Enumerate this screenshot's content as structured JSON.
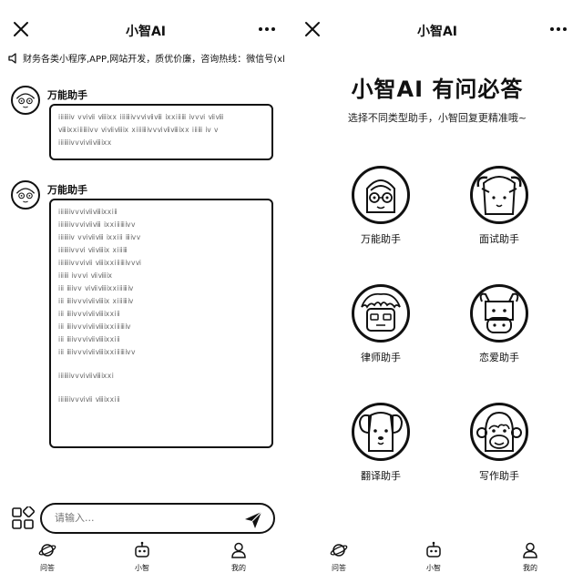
{
  "left": {
    "title": "小智AI",
    "notice": "财务各类小程序,APP,网站开发，质优价廉，咨询热线：微信号(xla",
    "messages": [
      {
        "sender": "万能助手",
        "lines": [
          "ⅰⅱⅲⅳ  ⅴⅵⅶ ⅷⅸⅹ ⅰⅱⅲⅳⅴⅵⅶⅷ ⅸⅹⅰⅱⅲ ⅳⅴⅵ ⅶⅷ",
          "ⅷⅸⅹⅰⅱⅲⅳⅴ ⅵⅶⅷⅸ ⅹⅰⅱⅲⅳⅴⅵⅶⅷⅸⅹ ⅰⅱⅲ ⅳ ⅴ",
          "ⅰⅱⅲⅳⅴⅵⅶⅷⅸⅹ"
        ]
      },
      {
        "sender": "万能助手",
        "lines": [
          "ⅰⅱⅲⅳⅴⅵⅶⅷⅸⅹⅰⅱ",
          "ⅰⅱⅲⅳⅴⅵⅶⅷ  ⅸⅹⅰⅱⅲⅳⅴ",
          "ⅰⅱⅲⅳ  ⅴⅵⅶⅷ  ⅸⅹⅰⅱ  ⅲⅳⅴ",
          "ⅰⅱⅲⅳⅴⅵ  ⅶⅷⅸ  ⅹⅰⅱⅲ",
          "ⅰⅱⅲⅳⅴⅵⅶ  ⅷⅸⅹⅰⅱⅲⅳⅴⅵ",
          "ⅰⅱⅲ  ⅳⅴⅵ  ⅶⅷⅸ",
          "ⅰⅱ  ⅲⅳⅴ  ⅵⅶⅷⅸⅹⅰⅱⅲⅳ",
          "ⅰⅱ  ⅲⅳⅴⅵⅶⅷⅸ  ⅹⅰⅱⅲⅳ",
          "ⅰⅱ  ⅲⅳⅴⅵⅶⅷⅸⅹⅰⅱ",
          "ⅰⅱ  ⅲⅳⅴⅵⅶⅷⅸⅹⅰⅱⅲⅳ",
          "ⅰⅱ  ⅲⅳⅴⅵⅶⅷⅸⅹⅰⅱ",
          "ⅰⅱ  ⅲⅳⅴⅵⅶⅷⅸⅹⅰⅱⅲⅳⅴ",
          "",
          "ⅰⅱⅲⅳⅴⅵⅶⅷⅸⅹⅰ",
          "",
          "ⅰⅱⅲⅳⅴⅵⅶ  ⅷⅸⅹⅰⅱ"
        ]
      }
    ],
    "input_placeholder": "请输入...",
    "tabs": [
      {
        "label": "问答",
        "icon": "planet-icon"
      },
      {
        "label": "小智",
        "icon": "robot-icon"
      },
      {
        "label": "我的",
        "icon": "person-icon"
      }
    ]
  },
  "right": {
    "title": "小智AI",
    "hero_title": "小智AI 有问必答",
    "hero_subtitle": "选择不同类型助手，小智回复更精准哦~",
    "assistants": [
      {
        "name": "万能助手",
        "icon": "girl-glasses-avatar-icon"
      },
      {
        "name": "面试助手",
        "icon": "sheep-avatar-icon"
      },
      {
        "name": "律师助手",
        "icon": "lawyer-avatar-icon"
      },
      {
        "name": "恋爱助手",
        "icon": "cow-avatar-icon"
      },
      {
        "name": "翻译助手",
        "icon": "dog-avatar-icon"
      },
      {
        "name": "写作助手",
        "icon": "monkey-avatar-icon"
      }
    ],
    "tabs": [
      {
        "label": "问答",
        "icon": "planet-icon"
      },
      {
        "label": "小智",
        "icon": "robot-icon"
      },
      {
        "label": "我的",
        "icon": "person-icon"
      }
    ]
  }
}
